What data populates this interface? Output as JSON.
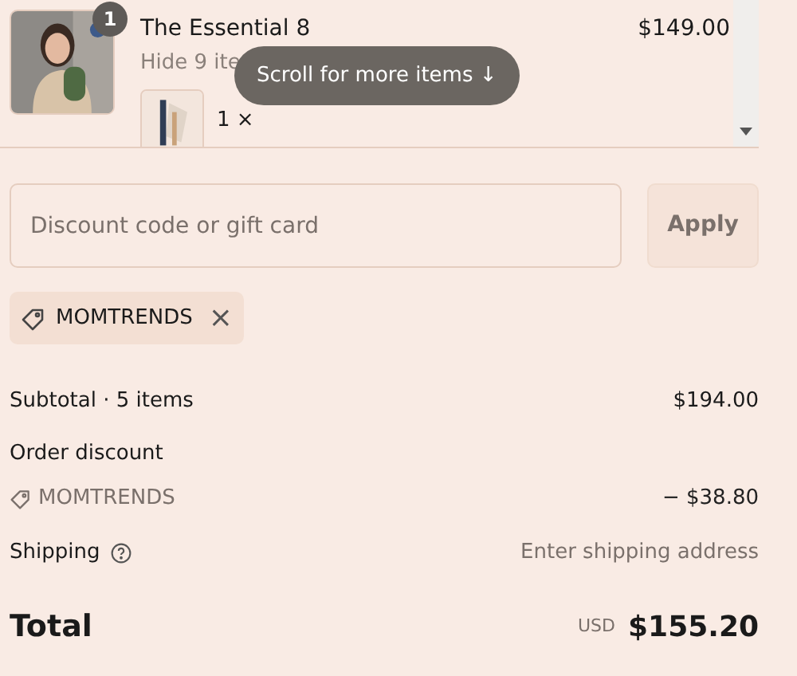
{
  "cart": {
    "item": {
      "quantity_badge": "1",
      "title": "The Essential 8",
      "price": "$149.00",
      "toggle": "Hide 9 ite",
      "sub_items": [
        {
          "name": "1 ×"
        }
      ]
    },
    "scroll_hint": "Scroll for more items ↓"
  },
  "discount": {
    "placeholder": "Discount code or gift card",
    "button": "Apply",
    "applied_codes": [
      {
        "code": "MOMTRENDS",
        "remove": "×"
      }
    ]
  },
  "summary": {
    "rows": [
      {
        "kind": "line",
        "label": "Subtotal · 5 items",
        "value": "$194.00"
      },
      {
        "kind": "heading",
        "label": "Order discount"
      },
      {
        "kind": "code",
        "label": "MOMTRENDS",
        "value": "− $38.80"
      },
      {
        "kind": "info",
        "label": "Shipping",
        "value": "Enter shipping address"
      }
    ],
    "total": {
      "label": "Total",
      "currency": "USD",
      "value": "$155.20"
    }
  }
}
